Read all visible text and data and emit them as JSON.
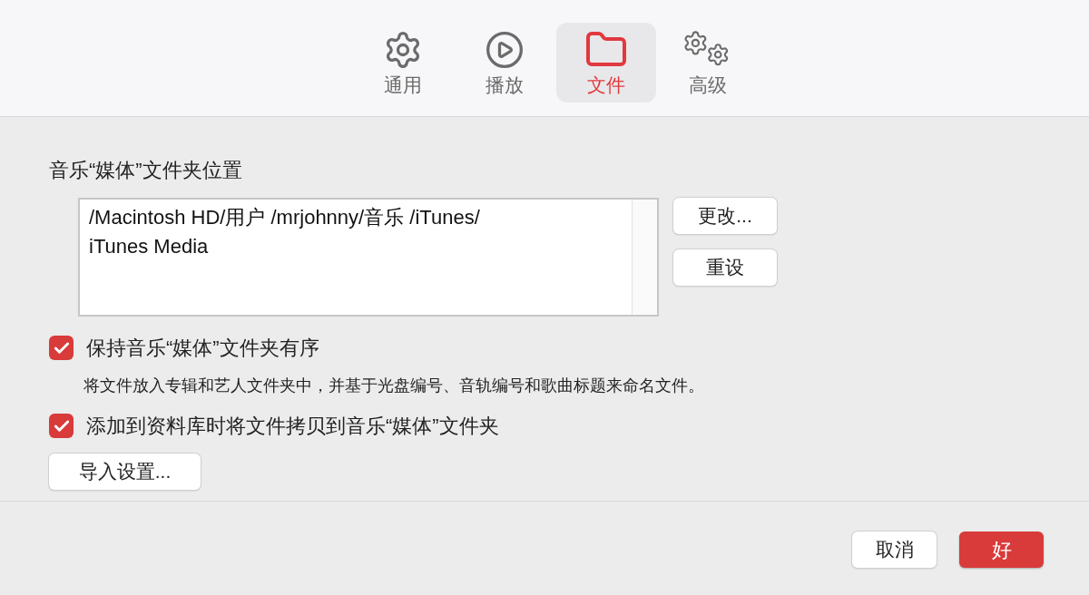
{
  "toolbar": {
    "tabs": [
      {
        "kind": "gear",
        "label": "通用",
        "selected": false
      },
      {
        "kind": "play",
        "label": "播放",
        "selected": false
      },
      {
        "kind": "folder",
        "label": "文件",
        "selected": true
      },
      {
        "kind": "gears",
        "label": "高级",
        "selected": false
      }
    ]
  },
  "media_folder": {
    "label": "音乐“媒体”文件夹位置",
    "path_lines": [
      "/Macintosh HD/用户 /mrjohnny/音乐 /iTunes/",
      "iTunes Media"
    ],
    "buttons": [
      "更改...",
      "重设"
    ]
  },
  "options": [
    {
      "label": "保持音乐“媒体”文件夹有序",
      "checked": true,
      "description": "将文件放入专辑和艺人文件夹中，并基于光盘编号、音轨编号和歌曲标题来命名文件。"
    },
    {
      "label": "添加到资料库时将文件拷贝到音乐“媒体”文件夹",
      "checked": true
    }
  ],
  "import_button": "导入设置...",
  "footer": {
    "cancel": "取消",
    "ok": "好"
  }
}
